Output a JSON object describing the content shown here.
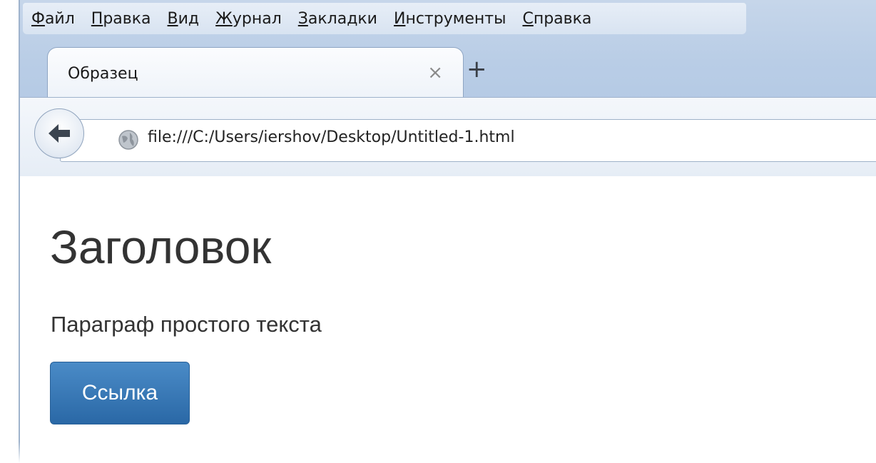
{
  "menu": {
    "items": [
      {
        "acc": "Ф",
        "rest": "айл"
      },
      {
        "acc": "П",
        "rest": "равка"
      },
      {
        "acc": "В",
        "rest": "ид"
      },
      {
        "acc": "Ж",
        "rest": "урнал"
      },
      {
        "acc": "З",
        "rest": "акладки"
      },
      {
        "acc": "И",
        "rest": "нструменты"
      },
      {
        "acc": "С",
        "rest": "правка"
      }
    ]
  },
  "tab": {
    "title": "Образец",
    "close_glyph": "×",
    "new_tab_glyph": "+"
  },
  "nav": {
    "url": "file:///C:/Users/iershov/Desktop/Untitled-1.html",
    "back_icon": "back-arrow-icon",
    "site_icon": "globe-icon"
  },
  "page": {
    "heading": "Заголовок",
    "paragraph": "Параграф простого текста",
    "button_label": "Ссылка"
  },
  "colors": {
    "frame": "#b9cde6",
    "button": "#2f6fad",
    "text": "#333333"
  }
}
